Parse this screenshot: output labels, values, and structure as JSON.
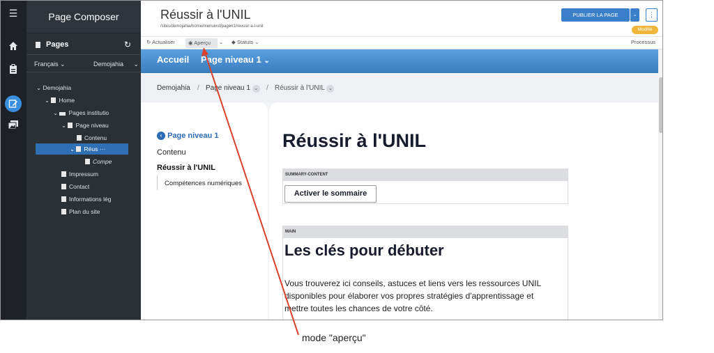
{
  "rail": {
    "icons": [
      "menu-icon",
      "home-icon",
      "clipboard-icon",
      "edit-icon",
      "image-icon"
    ]
  },
  "sidebar": {
    "title": "Page Composer",
    "pages_label": "Pages",
    "language": "Français",
    "site": "Demojahia",
    "tree": [
      "Demojahia",
      "Home",
      "Pages institutio",
      "Page niveau",
      "Contenu",
      "Réus",
      "Compe",
      "Impressum",
      "Contact",
      "Informations lég",
      "Plan du site"
    ],
    "selected_more": "···"
  },
  "header": {
    "title": "Réussir à l'UNIL",
    "path": "/sites/demojahia/home/menuinst/pagen1/reussir-a-l-unil",
    "publish_label": "PUBLIER LA PAGE",
    "status_badge": "Modifié"
  },
  "toolbar": {
    "refresh": "Actualiser",
    "preview": "Aperçu",
    "status": "Statuts",
    "process": "Processus"
  },
  "site_nav": {
    "home": "Accueil",
    "level1": "Page niveau 1"
  },
  "breadcrumb": {
    "items": [
      "Demojahia",
      "Page niveau 1",
      "Réussir à l'UNIL"
    ],
    "sep": "/"
  },
  "left_nav": {
    "back": "Page niveau 1",
    "items": [
      "Contenu",
      "Réussir à l'UNIL",
      "Compétences numériques"
    ]
  },
  "content": {
    "title": "Réussir à l'UNIL",
    "summary_label": "SUMMARY-CONTENT",
    "summary_button": "Activer le sommaire",
    "main_label": "MAIN",
    "heading": "Les clés pour débuter",
    "paragraph_lines": [
      "Vous trouverez ici conseils, astuces et liens vers les ressources UNIL",
      "disponibles pour élaborer vos propres stratégies d'apprentissage et",
      "mettre toutes les chances de votre côté."
    ]
  },
  "annotation": {
    "caption": "mode \"aperçu\"",
    "color": "#d9422b"
  },
  "colors": {
    "accent": "#3a7fc9",
    "selected": "#2f6fb3",
    "badge": "#f0b63c",
    "rail": "#1e2226",
    "sidebar": "#2b3035"
  }
}
